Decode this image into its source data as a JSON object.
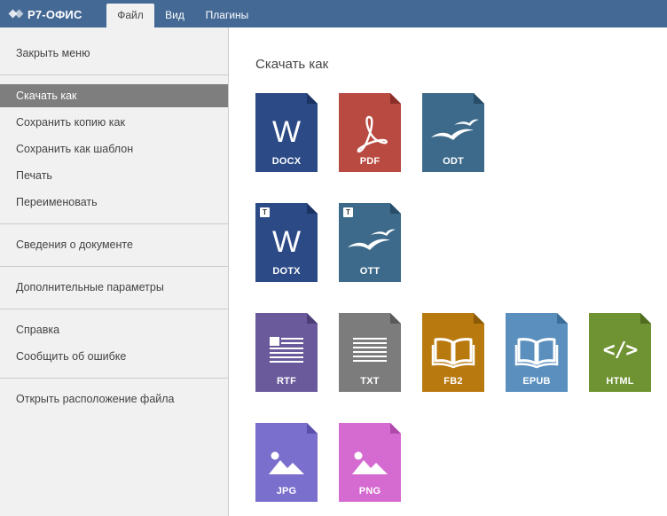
{
  "header": {
    "logo_text": "Р7-ОФИС",
    "tabs": [
      {
        "label": "Файл",
        "active": true
      },
      {
        "label": "Вид",
        "active": false
      },
      {
        "label": "Плагины",
        "active": false
      }
    ],
    "bar_color": "#446995"
  },
  "sidebar": {
    "items": [
      {
        "label": "Закрыть меню"
      },
      {
        "label": "Скачать как",
        "active": true
      },
      {
        "label": "Сохранить копию как"
      },
      {
        "label": "Сохранить как шаблон"
      },
      {
        "label": "Печать"
      },
      {
        "label": "Переименовать"
      },
      {
        "label": "Сведения о документе"
      },
      {
        "label": "Дополнительные параметры"
      },
      {
        "label": "Справка"
      },
      {
        "label": "Сообщить об ошибке"
      },
      {
        "label": "Открыть расположение файла"
      }
    ]
  },
  "main": {
    "title": "Скачать как",
    "formats": [
      {
        "label": "DOCX",
        "icon": "word-icon",
        "color": "#2b4a86"
      },
      {
        "label": "PDF",
        "icon": "pdf-icon",
        "color": "#b84a41"
      },
      {
        "label": "ODT",
        "icon": "seagull-icon",
        "color": "#3d6a8a"
      },
      {
        "label": "DOTX",
        "icon": "word-icon",
        "color": "#2b4a86",
        "badge": "T"
      },
      {
        "label": "OTT",
        "icon": "seagull-icon",
        "color": "#3d6a8a",
        "badge": "T"
      },
      {
        "label": "RTF",
        "icon": "rtf-icon",
        "color": "#6a5a9c"
      },
      {
        "label": "TXT",
        "icon": "txt-icon",
        "color": "#7c7c7c"
      },
      {
        "label": "FB2",
        "icon": "book-icon",
        "color": "#b8790f"
      },
      {
        "label": "EPUB",
        "icon": "book-icon",
        "color": "#5a8fbe"
      },
      {
        "label": "HTML",
        "icon": "code-icon",
        "color": "#6f9232"
      },
      {
        "label": "JPG",
        "icon": "image-icon",
        "color": "#7a6fcc"
      },
      {
        "label": "PNG",
        "icon": "image-icon",
        "color": "#d56bd0"
      }
    ]
  }
}
